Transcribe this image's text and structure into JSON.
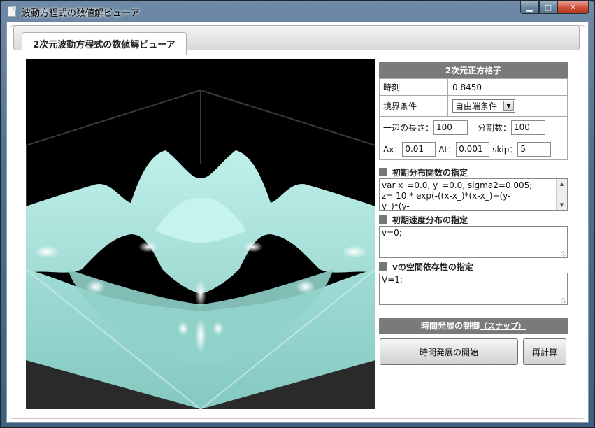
{
  "window": {
    "title": "波動方程式の数値解ビューア"
  },
  "caption_buttons": {
    "min": "▁",
    "max": "□",
    "close": "✕"
  },
  "tab": {
    "label": "2次元波動方程式の数値解ビューア"
  },
  "lattice": {
    "header": "2次元正方格子",
    "time_label": "時刻",
    "time_value": "0.8450",
    "boundary_label": "境界条件",
    "boundary_value": "自由端条件",
    "side_length_label": "一辺の長さ：",
    "side_length_value": "100",
    "divisions_label": "分割数：",
    "divisions_value": "100",
    "dx_label": "Δx：",
    "dx_value": "0.01",
    "dt_label": "Δt：",
    "dt_value": "0.001",
    "skip_label": "skip：",
    "skip_value": "5"
  },
  "initial_distribution": {
    "label": "初期分布関数の指定",
    "line1": "var x_=0.0, y_=0.0, sigma2=0.005;",
    "line2": "z= 10 * exp(-((x-x_)*(x-x_)+(y-",
    "line3": "y_)*(y-"
  },
  "initial_velocity": {
    "label": "初期速度分布の指定",
    "value": "v=0;"
  },
  "v_spatial": {
    "label": "vの空間依存性の指定",
    "value": "V=1;"
  },
  "control": {
    "header": "時間発展の制御",
    "snap_link": "（スナップ）",
    "start_button": "時間発展の開始",
    "recalc_button": "再計算"
  },
  "icons": {
    "window_icon": "document-icon",
    "select_arrow": "chevron-down-icon"
  },
  "colors": {
    "surface": "#a8e2dc",
    "header_bg": "#7a7a7a",
    "viewport_bg": "#000000"
  }
}
